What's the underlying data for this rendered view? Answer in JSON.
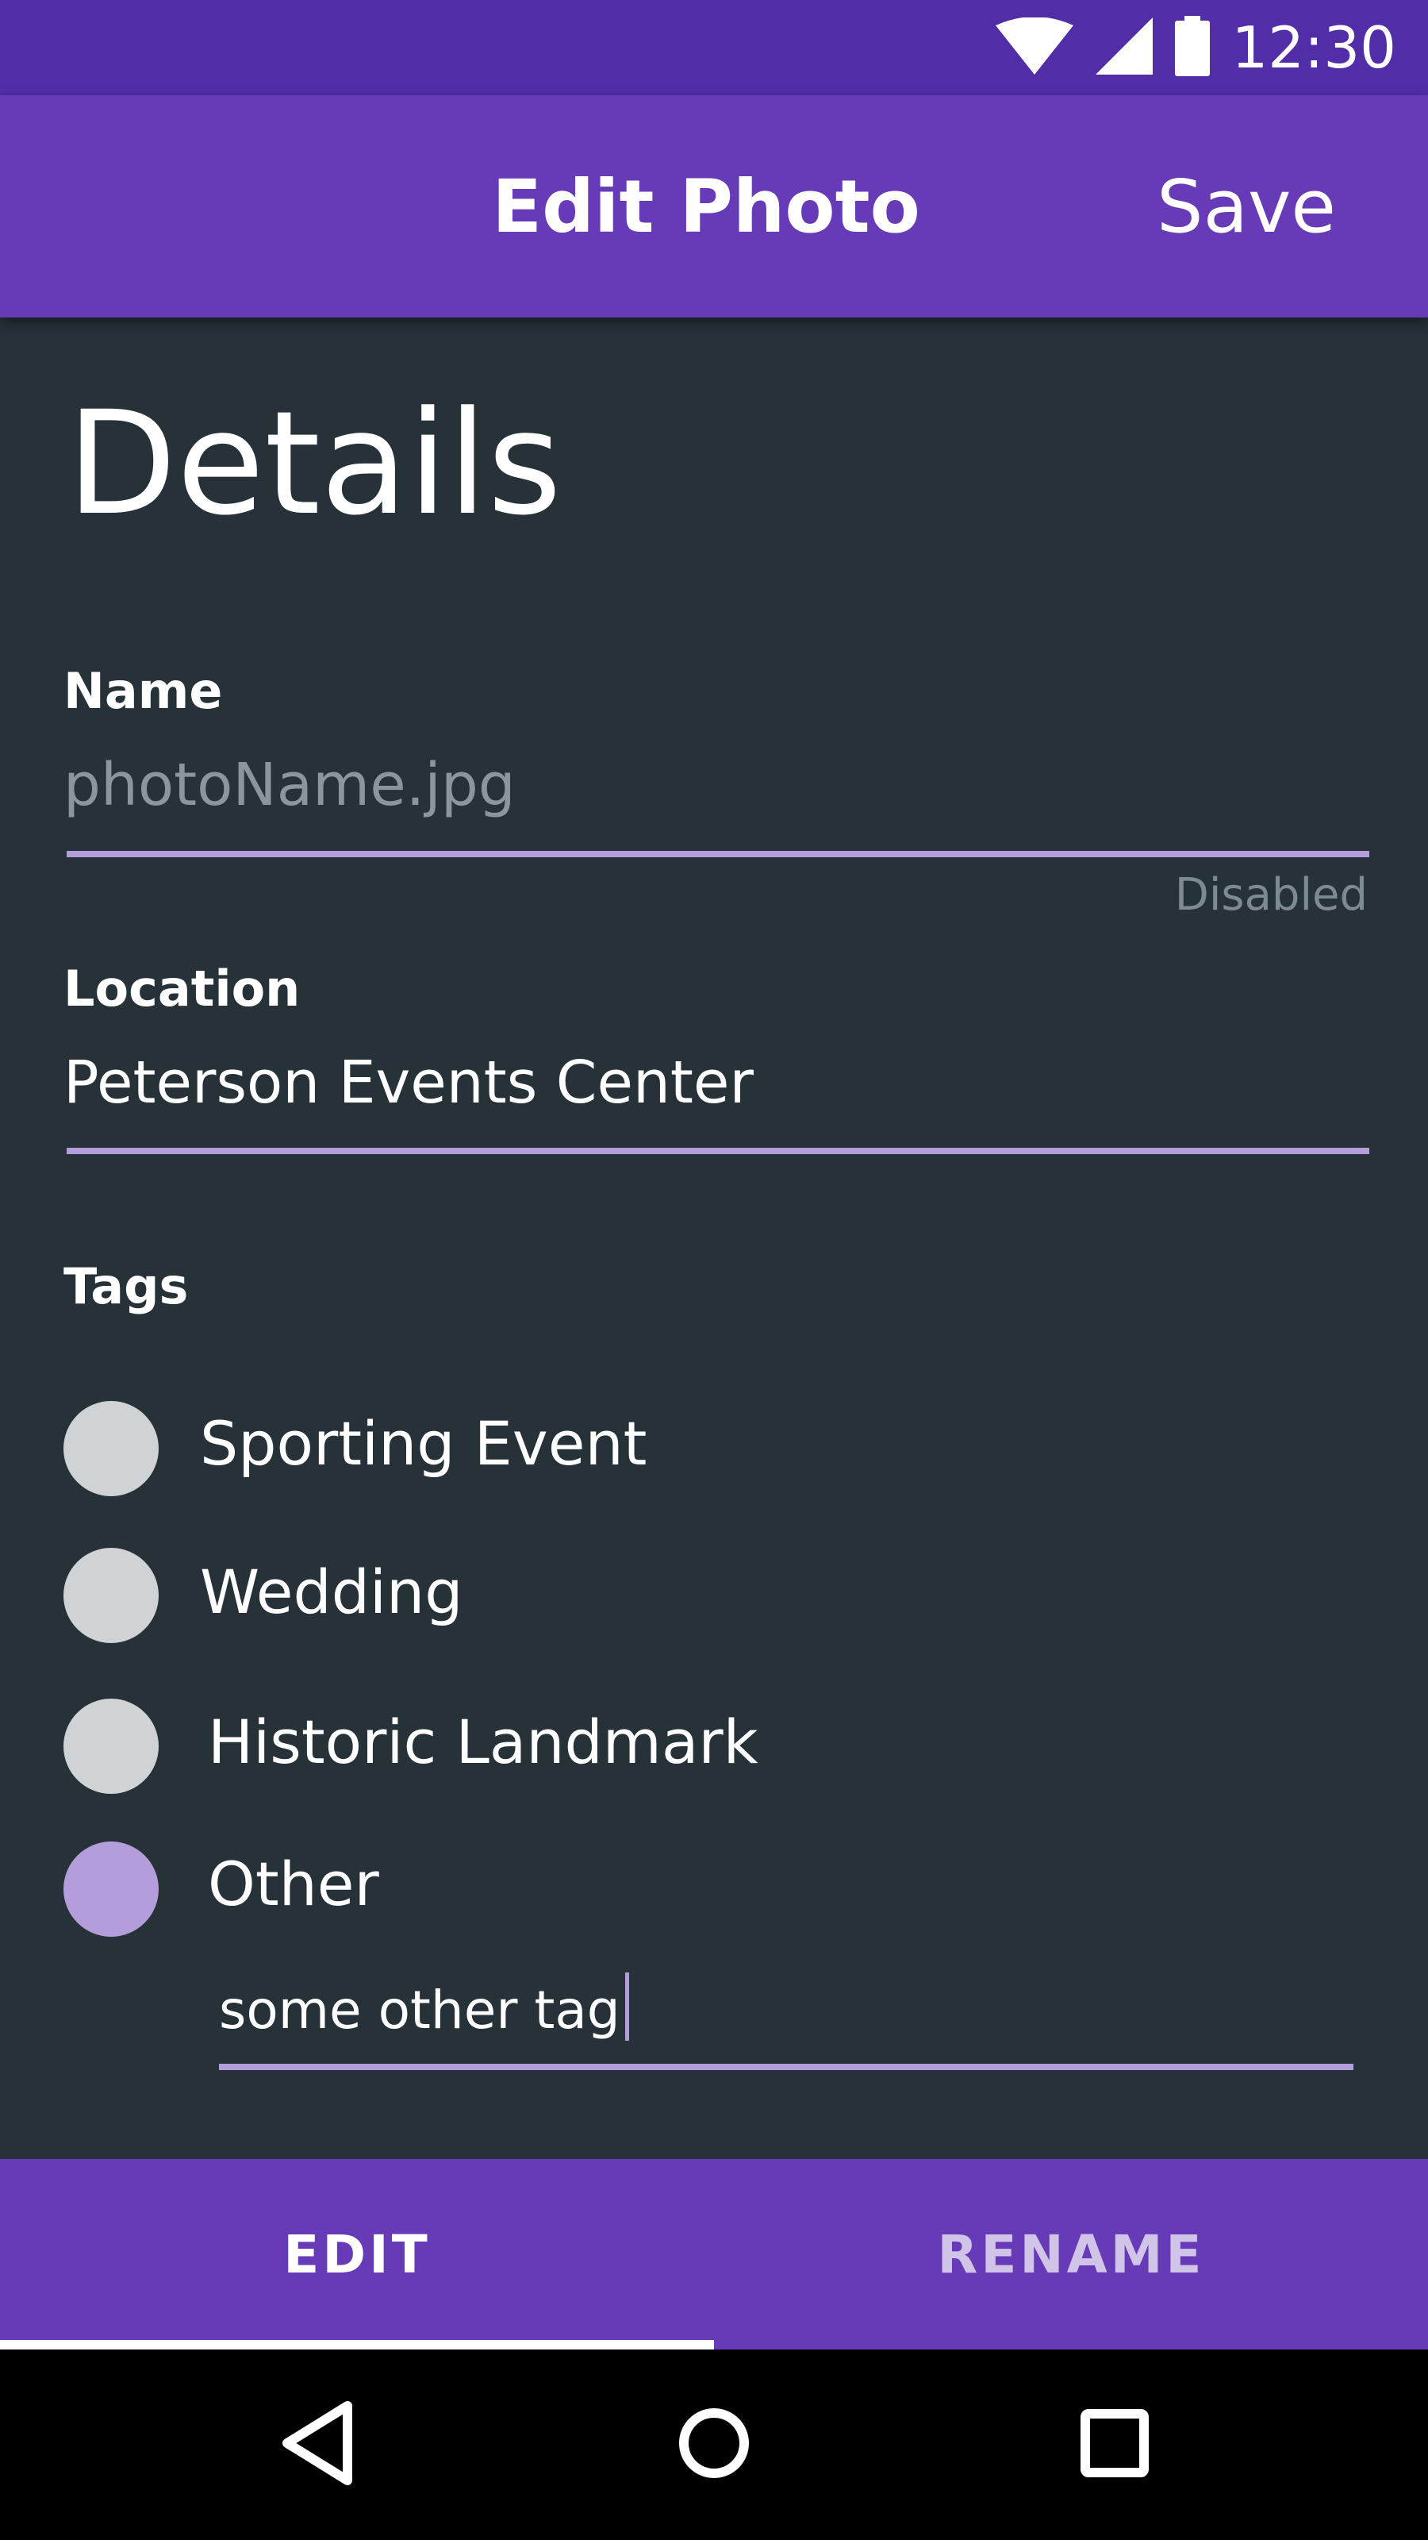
{
  "status_bar": {
    "time": "12:30",
    "icons": [
      "wifi-icon",
      "signal-icon",
      "battery-icon"
    ]
  },
  "app_bar": {
    "title": "Edit Photo",
    "save_label": "Save"
  },
  "details": {
    "section_title": "Details",
    "name": {
      "label": "Name",
      "value": "photoName.jpg",
      "helper": "Disabled",
      "disabled": true
    },
    "location": {
      "label": "Location",
      "value": "Peterson Events Center"
    },
    "tags": {
      "label": "Tags",
      "options": [
        {
          "label": "Sporting Event",
          "checked": false
        },
        {
          "label": "Wedding",
          "checked": false
        },
        {
          "label": "Historic Landmark",
          "checked": false
        },
        {
          "label": "Other",
          "checked": true
        }
      ],
      "other_value": "some other tag"
    }
  },
  "tabs": [
    {
      "label": "EDIT",
      "selected": true
    },
    {
      "label": "RENAME",
      "selected": false
    }
  ],
  "nav": {
    "icons": [
      "back-icon",
      "home-icon",
      "recents-icon"
    ]
  },
  "colors": {
    "primary": "#673AB7",
    "primary_dark": "#512DA8",
    "accent": "#B39DDB",
    "background": "#263238"
  }
}
